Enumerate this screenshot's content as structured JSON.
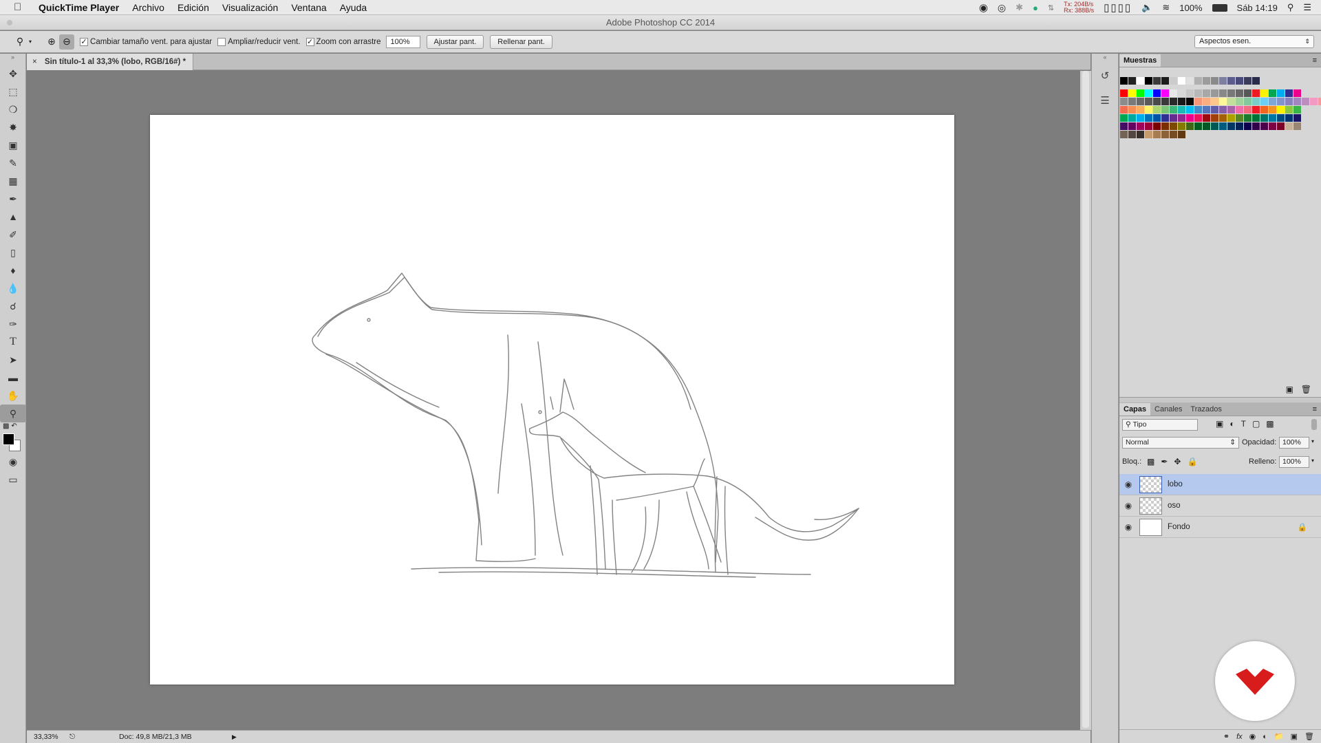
{
  "menubar": {
    "app_name": "QuickTime Player",
    "items": [
      "Archivo",
      "Edición",
      "Visualización",
      "Ventana",
      "Ayuda"
    ],
    "net_tx": "Tx: 204B/s",
    "net_rx": "Rx: 388B/s",
    "battery": "100%",
    "clock": "Sáb 14:19"
  },
  "window": {
    "title": "Adobe Photoshop CC 2014"
  },
  "options": {
    "resize_windows_label": "Cambiar tamaño vent. para ajustar",
    "zoom_all_label": "Ampliar/reducir vent.",
    "scrubby_zoom_label": "Zoom con arrastre",
    "zoom_value": "100%",
    "fit_screen_label": "Ajustar pant.",
    "fill_screen_label": "Rellenar pant.",
    "workspace": "Aspectos esen."
  },
  "document": {
    "tab_title": "Sin título-1 al 33,3% (lobo, RGB/16#) *"
  },
  "status": {
    "zoom": "33,33%",
    "doc_size": "Doc: 49,8 MB/21,3 MB"
  },
  "swatches": {
    "title": "Muestras",
    "rows": [
      [
        "#000000",
        "#222222",
        "#ffffff",
        "#000000",
        "#3a3a3a",
        "#1c1c1c",
        "#cccccc",
        "#ffffff",
        "#e0e0e0",
        "#b0b0b0",
        "#9c9c9c",
        "#8a8a8a",
        "#7e7e9e",
        "#5c5c8c",
        "#4a4a7a",
        "#3a3a5a",
        "#2a2a4a"
      ],
      [
        "#ff0000",
        "#ffff00",
        "#00ff00",
        "#00ffff",
        "#0000ff",
        "#ff00ff",
        "#e8e8e8",
        "#d8d8d8",
        "#c8c8c8",
        "#b8b8b8",
        "#a8a8a8",
        "#989898",
        "#888888",
        "#787878",
        "#686868",
        "#585858",
        "#ed1c24",
        "#fff200",
        "#00a651",
        "#00aeef",
        "#2e3192",
        "#ec008c"
      ],
      [
        "#8c8c8c",
        "#7a7a7a",
        "#6a6a6a",
        "#5a5a5a",
        "#4a4a4a",
        "#3a3a3a",
        "#2a2a2a",
        "#1a1a1a",
        "#0a0a0a",
        "#f7977a",
        "#f9ad81",
        "#fdc68a",
        "#fff79a",
        "#c4df9b",
        "#a3d39c",
        "#82ca9d",
        "#7bcdc8",
        "#6ecff6",
        "#7ea7d8",
        "#8493ca",
        "#8882be",
        "#a187be",
        "#bc8dbf",
        "#f49ac2",
        "#f6989d"
      ],
      [
        "#f26c4f",
        "#f68e55",
        "#fbaf5c",
        "#fff467",
        "#acd372",
        "#7cc576",
        "#3bb878",
        "#1abbb4",
        "#00bff3",
        "#438cca",
        "#5574b9",
        "#605ca8",
        "#855fa8",
        "#a763a8",
        "#f06ea9",
        "#f26d7d",
        "#ed1c24",
        "#f26522",
        "#f7941d",
        "#fff200",
        "#8dc73f",
        "#39b54a"
      ],
      [
        "#00a651",
        "#00a99d",
        "#00aeef",
        "#0072bc",
        "#0054a6",
        "#2e3192",
        "#662d91",
        "#92278f",
        "#ec008c",
        "#ed145b",
        "#9e0b0f",
        "#a0410d",
        "#a36209",
        "#aba000",
        "#598527",
        "#1a7b30",
        "#007236",
        "#00746b",
        "#0076a3",
        "#004b80",
        "#003471",
        "#1b1464"
      ],
      [
        "#440e62",
        "#630460",
        "#9e005d",
        "#9e0039",
        "#790000",
        "#7b2e00",
        "#7d4900",
        "#827b00",
        "#406618",
        "#005e20",
        "#005826",
        "#005952",
        "#005b7f",
        "#003663",
        "#002157",
        "#0d004c",
        "#32004b",
        "#4b0049",
        "#7b0046",
        "#7a0026",
        "#c7b299",
        "#998675"
      ],
      [
        "#736357",
        "#534741",
        "#37302d",
        "#c69c6d",
        "#a67c52",
        "#8c6239",
        "#754c24",
        "#603913"
      ]
    ]
  },
  "layers_panel": {
    "tabs": [
      "Capas",
      "Canales",
      "Trazados"
    ],
    "filter": "Tipo",
    "blend_mode": "Normal",
    "opacity_label": "Opacidad:",
    "opacity": "100%",
    "lock_label": "Bloq.:",
    "fill_label": "Relleno:",
    "fill": "100%",
    "layers": [
      {
        "name": "lobo",
        "selected": true,
        "locked": false,
        "transparent": true
      },
      {
        "name": "oso",
        "selected": false,
        "locked": false,
        "transparent": true
      },
      {
        "name": "Fondo",
        "selected": false,
        "locked": true,
        "transparent": false
      }
    ]
  },
  "colors": {
    "foreground": "#000000",
    "background": "#ffffff",
    "selection": "#b5c9ef",
    "logo_red": "#d81b1b"
  }
}
